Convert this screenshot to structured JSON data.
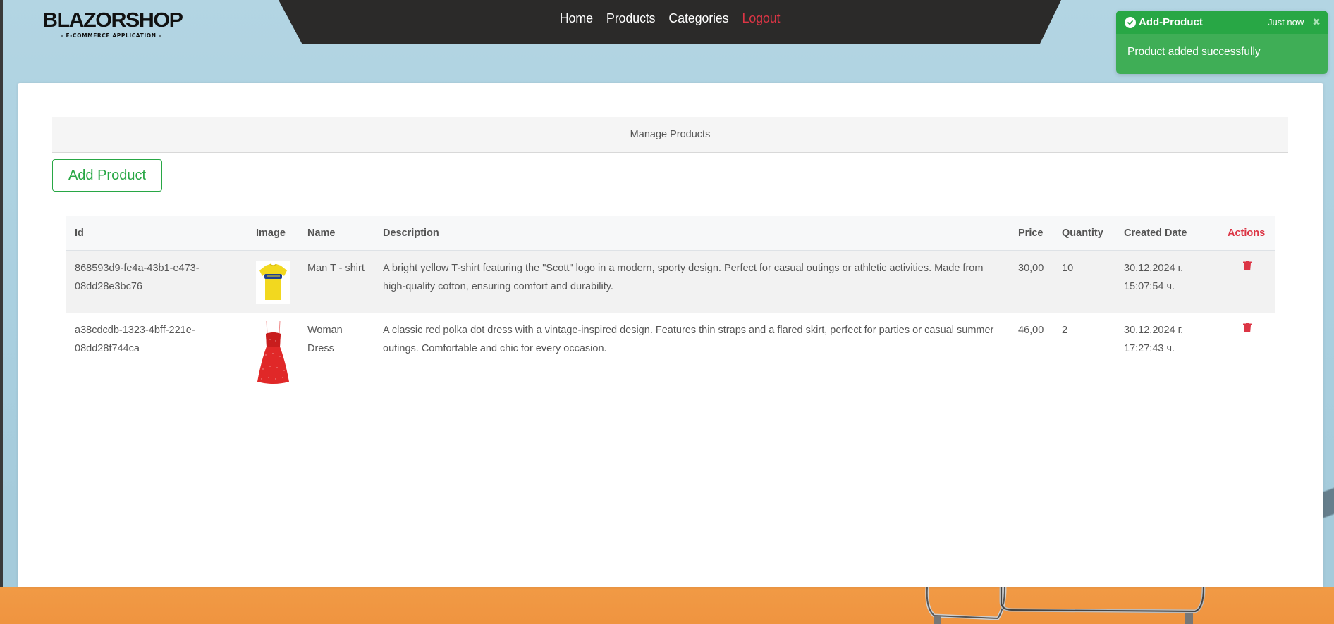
{
  "brand": {
    "title": "BLAZORSHOP",
    "subtitle": "– E-COMMERCE APPLICATION –"
  },
  "nav": {
    "items": [
      {
        "label": "Home"
      },
      {
        "label": "Products"
      },
      {
        "label": "Categories"
      },
      {
        "label": "Logout"
      }
    ]
  },
  "toast": {
    "icon": "check-circle-icon",
    "title": "Add-Product",
    "time": "Just now",
    "close_icon": "close-icon",
    "message": "Product added successfully",
    "color": "#28a745"
  },
  "page": {
    "header": "Manage Products",
    "add_button": "Add Product"
  },
  "table": {
    "columns": [
      "Id",
      "Image",
      "Name",
      "Description",
      "Price",
      "Quantity",
      "Created Date",
      "Actions"
    ],
    "rows": [
      {
        "id": "868593d9-fe4a-43b1-e473-08dd28e3bc76",
        "image": "yellow-tshirt-image",
        "name": "Man T - shirt",
        "description": "A bright yellow T-shirt featuring the \"Scott\" logo in a modern, sporty design. Perfect for casual outings or athletic activities. Made from high-quality cotton, ensuring comfort and durability.",
        "price": "30,00",
        "quantity": "10",
        "created_date": "30.12.2024 г. 15:07:54 ч.",
        "action_icon": "trash-icon"
      },
      {
        "id": "a38cdcdb-1323-4bff-221e-08dd28f744ca",
        "image": "red-dress-image",
        "name": "Woman Dress",
        "description": "A classic red polka dot dress with a vintage-inspired design. Features thin straps and a flared skirt, perfect for parties or casual summer outings. Comfortable and chic for every occasion.",
        "price": "46,00",
        "quantity": "2",
        "created_date": "30.12.2024 г. 17:27:43 ч.",
        "action_icon": "trash-icon"
      }
    ]
  },
  "colors": {
    "accent_green": "#28a745",
    "danger_red": "#dc3545",
    "navbar": "#2b2a29"
  }
}
